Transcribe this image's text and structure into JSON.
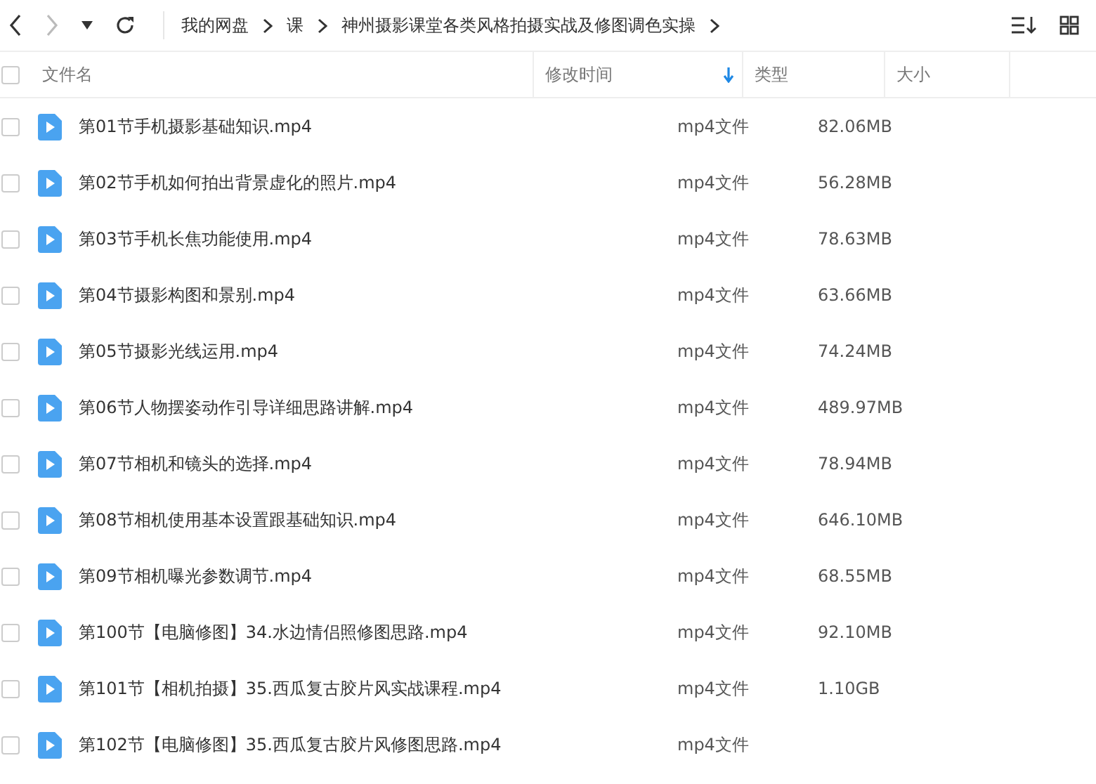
{
  "breadcrumb": [
    "我的网盘",
    "课",
    "神州摄影课堂各类风格拍摄实战及修图调色实操"
  ],
  "select_all_checked": false,
  "columns": [
    {
      "label": "文件名",
      "sorted": false
    },
    {
      "label": "修改时间",
      "sorted": true
    },
    {
      "label": "类型",
      "sorted": false
    },
    {
      "label": "大小",
      "sorted": false
    }
  ],
  "rows": [
    {
      "checked": false,
      "name": "第01节手机摄影基础知识.mp4",
      "type": "mp4文件",
      "size": "82.06MB"
    },
    {
      "checked": false,
      "name": "第02节手机如何拍出背景虚化的照片.mp4",
      "type": "mp4文件",
      "size": "56.28MB"
    },
    {
      "checked": false,
      "name": "第03节手机长焦功能使用.mp4",
      "type": "mp4文件",
      "size": "78.63MB"
    },
    {
      "checked": false,
      "name": "第04节摄影构图和景别.mp4",
      "type": "mp4文件",
      "size": "63.66MB"
    },
    {
      "checked": false,
      "name": "第05节摄影光线运用.mp4",
      "type": "mp4文件",
      "size": "74.24MB"
    },
    {
      "checked": false,
      "name": "第06节人物摆姿动作引导详细思路讲解.mp4",
      "type": "mp4文件",
      "size": "489.97MB"
    },
    {
      "checked": false,
      "name": "第07节相机和镜头的选择.mp4",
      "type": "mp4文件",
      "size": "78.94MB"
    },
    {
      "checked": false,
      "name": "第08节相机使用基本设置跟基础知识.mp4",
      "type": "mp4文件",
      "size": "646.10MB"
    },
    {
      "checked": false,
      "name": "第09节相机曝光参数调节.mp4",
      "type": "mp4文件",
      "size": "68.55MB"
    },
    {
      "checked": false,
      "name": "第100节【电脑修图】34.水边情侣照修图思路.mp4",
      "type": "mp4文件",
      "size": "92.10MB"
    },
    {
      "checked": false,
      "name": "第101节【相机拍摄】35.西瓜复古胶片风实战课程.mp4",
      "type": "mp4文件",
      "size": "1.10GB"
    },
    {
      "checked": false,
      "name": "第102节【电脑修图】35.西瓜复古胶片风修图思路.mp4",
      "type": "mp4文件"
    }
  ]
}
